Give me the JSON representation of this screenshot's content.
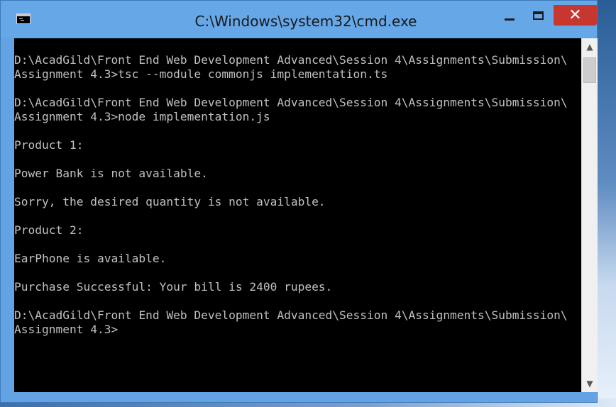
{
  "window": {
    "title": "C:\\Windows\\system32\\cmd.exe",
    "close_label": "✕"
  },
  "console": {
    "lines": [
      "D:\\AcadGild\\Front End Web Development Advanced\\Session 4\\Assignments\\Submission\\",
      "Assignment 4.3>tsc --module commonjs implementation.ts",
      "",
      "D:\\AcadGild\\Front End Web Development Advanced\\Session 4\\Assignments\\Submission\\",
      "Assignment 4.3>node implementation.js",
      "",
      "Product 1:",
      "",
      "Power Bank is not available.",
      "",
      "Sorry, the desired quantity is not available.",
      "",
      "Product 2:",
      "",
      "EarPhone is available.",
      "",
      "Purchase Successful: Your bill is 2400 rupees.",
      "",
      "D:\\AcadGild\\Front End Web Development Advanced\\Session 4\\Assignments\\Submission\\",
      "Assignment 4.3>"
    ]
  },
  "scrollbar": {
    "up_arrow": "▲",
    "down_arrow": "▼"
  },
  "colors": {
    "titlebar": "#66a7e8",
    "close_button": "#c7362f",
    "console_bg": "#000000",
    "console_fg": "#c0c0c0"
  }
}
